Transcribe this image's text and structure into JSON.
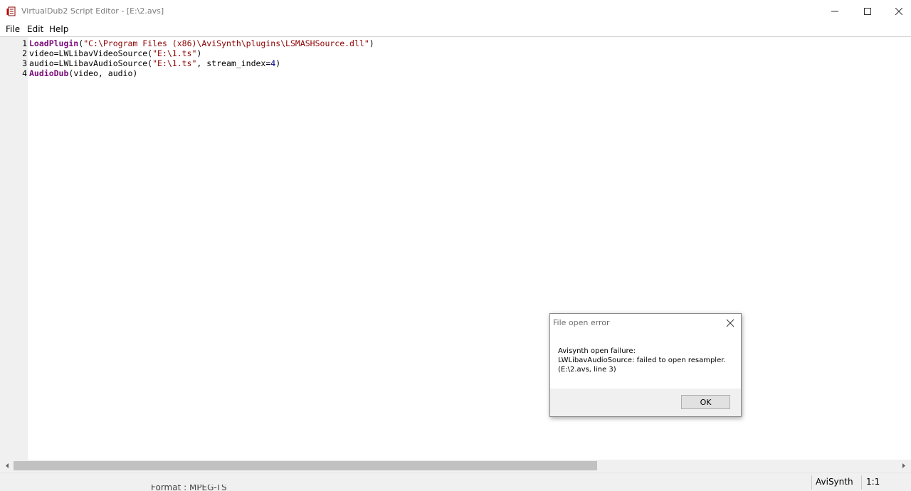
{
  "window": {
    "title": "VirtualDub2 Script Editor - [E:\\2.avs]"
  },
  "menu": [
    "File",
    "Edit",
    "Help"
  ],
  "editor": {
    "lines": [
      {
        "num": "1",
        "tokens": [
          {
            "t": "LoadPlugin",
            "c": "kw"
          },
          {
            "t": "(",
            "c": "plain"
          },
          {
            "t": "\"C:\\Program Files (x86)\\AviSynth\\plugins\\LSMASHSource.dll\"",
            "c": "str"
          },
          {
            "t": ")",
            "c": "plain"
          }
        ]
      },
      {
        "num": "2",
        "tokens": [
          {
            "t": "video=LWLibavVideoSource(",
            "c": "plain"
          },
          {
            "t": "\"E:\\1.ts\"",
            "c": "str"
          },
          {
            "t": ")",
            "c": "plain"
          }
        ]
      },
      {
        "num": "3",
        "tokens": [
          {
            "t": "audio=LWLibavAudioSource(",
            "c": "plain"
          },
          {
            "t": "\"E:\\1.ts\"",
            "c": "str"
          },
          {
            "t": ", stream_index=",
            "c": "plain"
          },
          {
            "t": "4",
            "c": "num"
          },
          {
            "t": ")",
            "c": "plain"
          }
        ]
      },
      {
        "num": "4",
        "tokens": [
          {
            "t": "AudioDub",
            "c": "kw"
          },
          {
            "t": "(video, audio)",
            "c": "plain"
          }
        ]
      }
    ]
  },
  "statusbar": {
    "language": "AviSynth",
    "position": "1:1",
    "background_text": "Format : MPEG-TS"
  },
  "dialog": {
    "title": "File open error",
    "message_lines": [
      "Avisynth open failure:",
      "LWLibavAudioSource: failed to open resampler.",
      "(E:\\2.avs, line 3)"
    ],
    "ok_label": "OK"
  }
}
